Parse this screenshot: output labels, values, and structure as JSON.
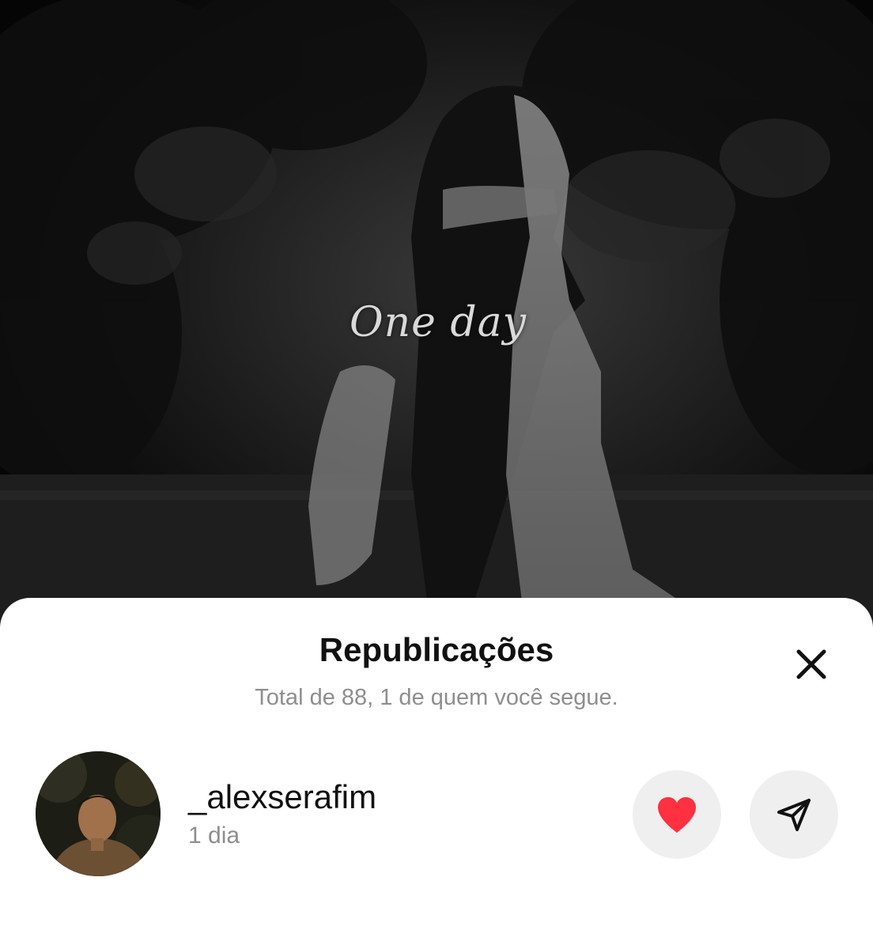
{
  "video": {
    "caption": "One day"
  },
  "sheet": {
    "title": "Republicações",
    "subtitle": "Total de 88, 1 de quem você segue.",
    "close_icon": "close-icon"
  },
  "reposts": [
    {
      "username": "_alexserafim",
      "time": "1 dia",
      "like_icon": "heart-icon",
      "share_icon": "send-icon"
    }
  ],
  "colors": {
    "heart": "#ff3040",
    "secondary_text": "#8e8e8e",
    "button_bg": "#efefef"
  }
}
